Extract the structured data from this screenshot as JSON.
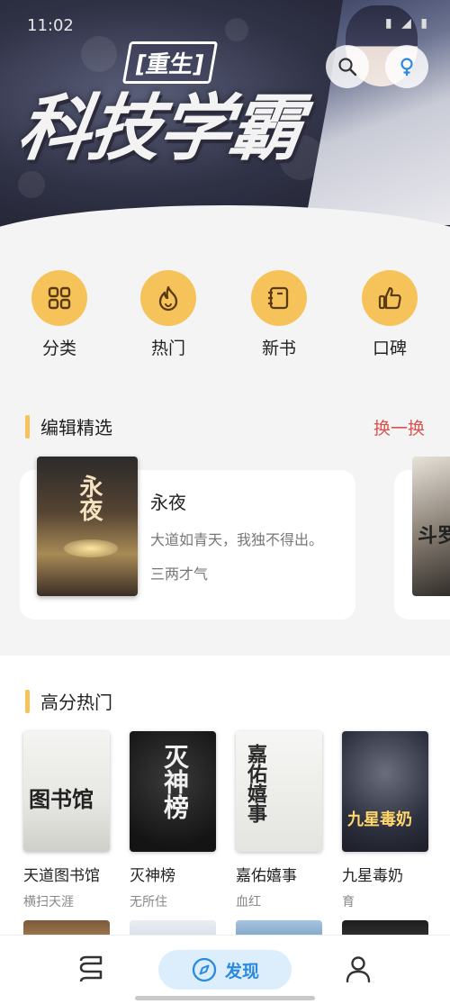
{
  "status": {
    "time": "11:02"
  },
  "banner": {
    "subtitle": "[重生]",
    "title": "科技学霸",
    "dot_count": 5,
    "active_dot": 0
  },
  "categories": [
    {
      "label": "分类",
      "icon": "grid-icon"
    },
    {
      "label": "热门",
      "icon": "flame-icon"
    },
    {
      "label": "新书",
      "icon": "notebook-icon"
    },
    {
      "label": "口碑",
      "icon": "thumbs-up-icon"
    }
  ],
  "editor_picks": {
    "title": "编辑精选",
    "swap_label": "换一换",
    "book": {
      "cover_text": "永夜",
      "title": "永夜",
      "desc": "大道如青天，我独不得出。",
      "author": "三两才气"
    },
    "peek_cover_text": "斗罗"
  },
  "high_score": {
    "title": "高分热门",
    "books": [
      {
        "title": "天道图书馆",
        "author": "横扫天涯",
        "cover_text": "图书馆"
      },
      {
        "title": "灭神榜",
        "author": "无所住",
        "cover_text": "灭神榜"
      },
      {
        "title": "嘉佑嬉事",
        "author": "血红",
        "cover_text": "嘉佑嬉事"
      },
      {
        "title": "九星毒奶",
        "author": "育",
        "cover_text": "九星毒奶"
      }
    ]
  },
  "nav": {
    "active_label": "发现"
  },
  "colors": {
    "accent": "#f6c35a",
    "swap": "#d9534f",
    "nav_active": "#2a8ae0",
    "nav_active_bg": "#dcedfb"
  }
}
